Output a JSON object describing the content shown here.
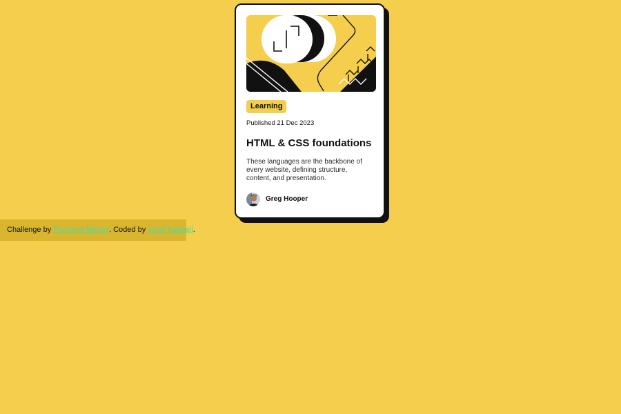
{
  "card": {
    "image_alt": "Abstract black, white and yellow illustration",
    "tag": "Learning",
    "published": "Published 21 Dec 2023",
    "title": "HTML & CSS foundations",
    "description": "These languages are the backbone of every website, defining structure, content, and presentation.",
    "author": {
      "name": "Greg Hooper"
    }
  },
  "attribution": {
    "prefix": "Challenge by ",
    "challenge_link": "Frontend Mentor",
    "middle": ". Coded by ",
    "coder_link": "Jonel Hatwell",
    "suffix": "."
  },
  "colors": {
    "background": "#f4ce4c",
    "card": "#ffffff",
    "ink": "#111111",
    "link": "#3ce0a8",
    "attribution_bg": "#dab62f"
  }
}
